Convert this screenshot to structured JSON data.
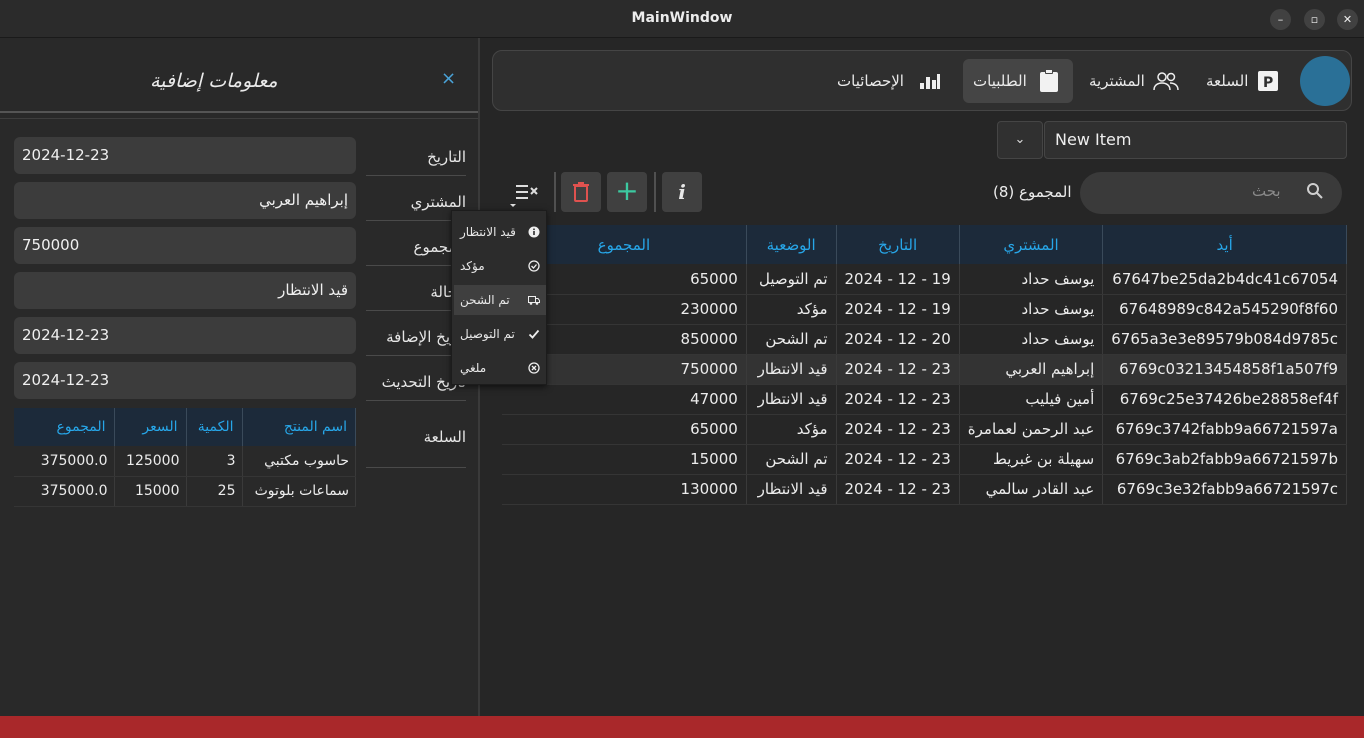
{
  "window": {
    "title": "MainWindow"
  },
  "details": {
    "title": "معلومات إضافية",
    "close": "×",
    "labels": [
      "التاريخ",
      "المشتري",
      "المجموع",
      "الحالة",
      "تاريخ الإضافة",
      "تاريخ التحديث",
      "السلعة"
    ],
    "date": "2024-12-23",
    "buyer": "إبراهيم العربي",
    "total": "750000",
    "status": "قيد الانتظار",
    "added_date": "2024-12-23",
    "updated_date": "2024-12-23",
    "cart": {
      "headers": [
        "اسم المنتج",
        "الكمية",
        "السعر",
        "المجموع"
      ],
      "rows": [
        [
          "حاسوب مكتبي",
          "3",
          "125000",
          "375000.0"
        ],
        [
          "سماعات بلوتوث",
          "25",
          "15000",
          "375000.0"
        ]
      ]
    }
  },
  "nav": {
    "items": [
      {
        "label": "السلعة",
        "icon": "p-box-icon"
      },
      {
        "label": "المشترية",
        "icon": "users-icon"
      },
      {
        "label": "الطلبيات",
        "icon": "clipboard-icon"
      },
      {
        "label": "الإحصائيات",
        "icon": "chart-icon"
      }
    ],
    "active": "الطلبيات"
  },
  "combo": {
    "value": "New Item",
    "arrow": "⌄"
  },
  "toolbar": {
    "info": "i",
    "add": "+"
  },
  "search": {
    "placeholder": "بحث",
    "count_label": "المجموع (8)"
  },
  "menu": {
    "items": [
      "قيد الانتظار",
      "مؤكد",
      "تم الشحن",
      "تم التوصيل",
      "ملغي"
    ],
    "highlighted": "تم الشحن"
  },
  "orders": {
    "headers": [
      "أيد",
      "المشتري",
      "التاريخ",
      "الوضعية",
      "المجموع"
    ],
    "rows": [
      [
        "67647be25da2b4dc41c67054",
        "يوسف حداد",
        "2024 - 12 - 19",
        "تم التوصيل",
        "65000"
      ],
      [
        "67648989c842a545290f8f60",
        "يوسف حداد",
        "2024 - 12 - 19",
        "مؤكد",
        "230000"
      ],
      [
        "6765a3e3e89579b084d9785c",
        "يوسف حداد",
        "2024 - 12 - 20",
        "تم الشحن",
        "850000"
      ],
      [
        "6769c03213454858f1a507f9",
        "إبراهيم العربي",
        "2024 - 12 - 23",
        "قيد الانتظار",
        "750000"
      ],
      [
        "6769c25e37426be28858ef4f",
        "أمين فيليب",
        "2024 - 12 - 23",
        "قيد الانتظار",
        "47000"
      ],
      [
        "6769c3742fabb9a66721597a",
        "عبد الرحمن لعمامرة",
        "2024 - 12 - 23",
        "مؤكد",
        "65000"
      ],
      [
        "6769c3ab2fabb9a66721597b",
        "سهيلة بن غبريط",
        "2024 - 12 - 23",
        "تم الشحن",
        "15000"
      ],
      [
        "6769c3e32fabb9a66721597c",
        "عبد القادر سالمي",
        "2024 - 12 - 23",
        "قيد الانتظار",
        "130000"
      ]
    ],
    "selected_index": 3
  },
  "colors": {
    "accent": "#27a6e8",
    "header_bg": "#1c2a3a",
    "avatar": "#2a7097",
    "delete": "#e0524f",
    "add": "#3cc9a0",
    "status_bar": "#a9282a"
  }
}
